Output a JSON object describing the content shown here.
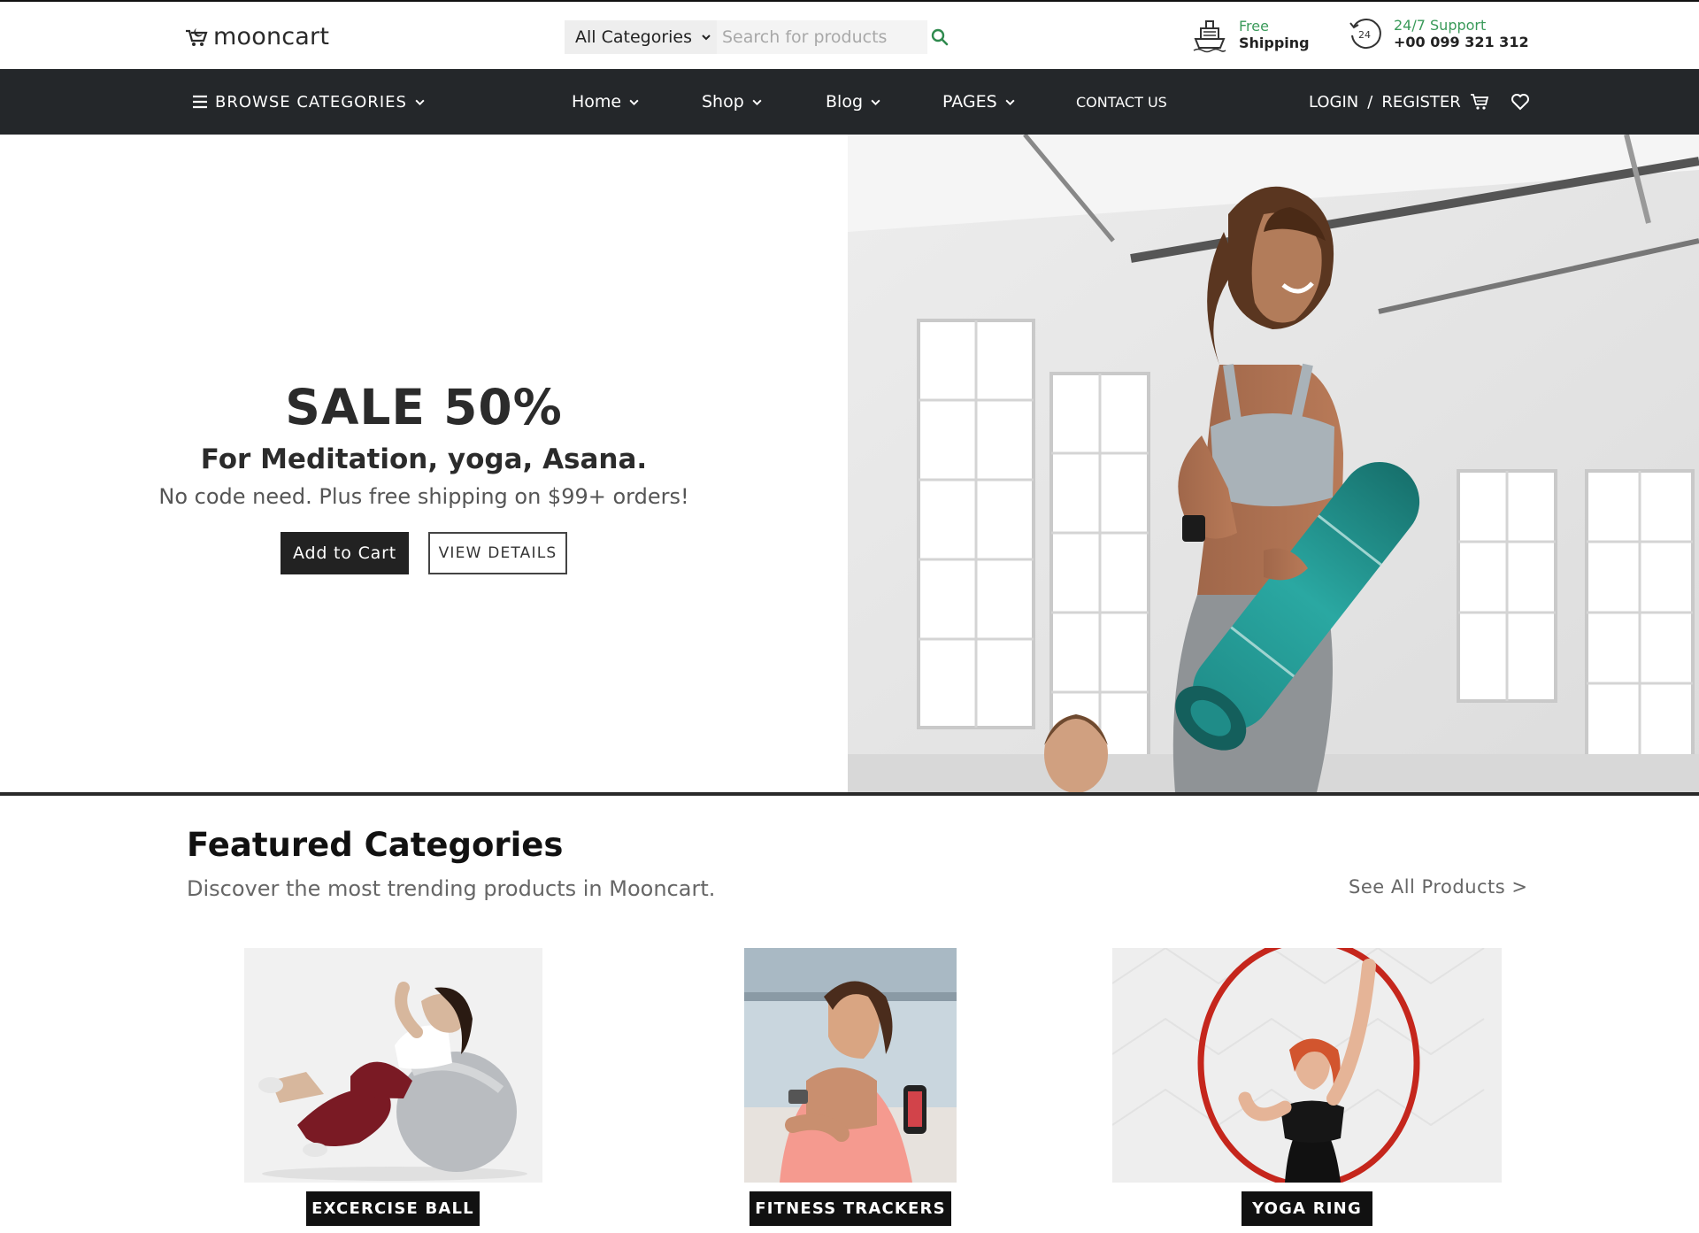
{
  "header": {
    "logo_text": "mooncart",
    "category_select": "All Categories",
    "search_placeholder": "Search for products",
    "shipping": {
      "line1": "Free",
      "line2": "Shipping"
    },
    "support": {
      "line1": "24/7 Support",
      "line2": "+00 099 321 312"
    }
  },
  "nav": {
    "browse": "BROWSE CATEGORIES",
    "home": "Home",
    "shop": "Shop",
    "blog": "Blog",
    "pages": "PAGES",
    "contact": "CONTACT US",
    "login": "LOGIN",
    "separator": "/",
    "register": "REGISTER"
  },
  "hero": {
    "headline": "SALE 50%",
    "subtitle": "For Meditation, yoga, Asana.",
    "description": "No code need. Plus free shipping on $99+ orders!",
    "primary_button": "Add to Cart",
    "secondary_button": "VIEW DETAILS"
  },
  "featured": {
    "title": "Featured Categories",
    "description": "Discover the most trending products in Mooncart.",
    "see_all": "See All Products >",
    "categories": [
      {
        "label": "EXCERCISE BALL"
      },
      {
        "label": "FITNESS TRACKERS"
      },
      {
        "label": "YOGA RING"
      }
    ]
  },
  "icons": {
    "logo": "cart-moon-icon",
    "dropdown": "chevron-down-icon",
    "search": "search-icon",
    "shipping": "ship-icon",
    "support": "support-24-icon",
    "menu": "hamburger-icon",
    "cart": "cart-icon",
    "wishlist": "heart-icon"
  },
  "colors": {
    "nav_background": "#24272a",
    "accent_green": "#3a9a5a",
    "dark_button": "#222222"
  }
}
